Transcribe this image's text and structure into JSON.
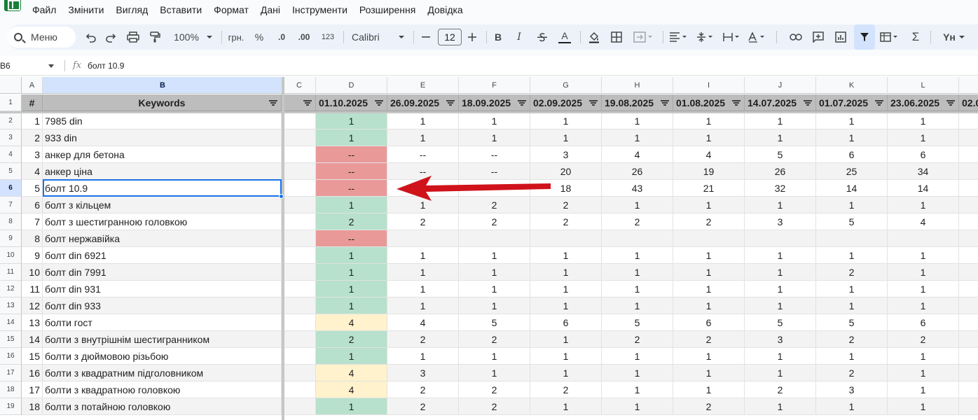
{
  "menu": [
    "Файл",
    "Змінити",
    "Вигляд",
    "Вставити",
    "Формат",
    "Дані",
    "Інструменти",
    "Розширення",
    "Довідка"
  ],
  "toolbar": {
    "menu_label": "Меню",
    "zoom": "100%",
    "currency": "грн.",
    "percent": "%",
    "dec_decrease": ".0",
    "dec_increase": ".00",
    "number_format": "123",
    "font": "Calibri",
    "font_size": "12",
    "bold": "B",
    "italic": "I",
    "text_color": "A",
    "sum": "Σ",
    "input_tools": "Yн"
  },
  "formula_bar": {
    "cell_ref": "B6",
    "fx": "fx",
    "value": "болт 10.9"
  },
  "columns": [
    "A",
    "B",
    "C",
    "D",
    "E",
    "F",
    "G",
    "H",
    "I",
    "J",
    "K",
    "L"
  ],
  "header_row": {
    "num": "#",
    "keyword": "Keywords",
    "dates": [
      "01.10.2025",
      "26.09.2025",
      "18.09.2025",
      "02.09.2025",
      "19.08.2025",
      "01.08.2025",
      "14.07.2025",
      "01.07.2025",
      "23.06.2025",
      "02.0"
    ]
  },
  "row_numbers": [
    "1",
    "2",
    "3",
    "4",
    "5",
    "6",
    "7",
    "8",
    "9",
    "10",
    "11",
    "12",
    "13",
    "14",
    "15",
    "16",
    "17",
    "18",
    "19"
  ],
  "rows": [
    {
      "n": "1",
      "kw": "7985 din",
      "v": [
        "1",
        "1",
        "1",
        "1",
        "1",
        "1",
        "1",
        "1",
        "1"
      ]
    },
    {
      "n": "2",
      "kw": "933 din",
      "v": [
        "1",
        "1",
        "1",
        "1",
        "1",
        "1",
        "1",
        "1",
        "1"
      ]
    },
    {
      "n": "3",
      "kw": "анкер для бетона",
      "v": [
        "--",
        "--",
        "--",
        "3",
        "4",
        "4",
        "5",
        "6",
        "6"
      ]
    },
    {
      "n": "4",
      "kw": "анкер ціна",
      "v": [
        "--",
        "--",
        "--",
        "20",
        "26",
        "19",
        "26",
        "25",
        "34"
      ]
    },
    {
      "n": "5",
      "kw": "болт 10.9",
      "v": [
        "--",
        "",
        "",
        "18",
        "43",
        "21",
        "32",
        "14",
        "14"
      ]
    },
    {
      "n": "6",
      "kw": "болт з кільцем",
      "v": [
        "1",
        "1",
        "2",
        "2",
        "1",
        "1",
        "1",
        "1",
        "1"
      ]
    },
    {
      "n": "7",
      "kw": "болт з шестигранною головкою",
      "v": [
        "2",
        "2",
        "2",
        "2",
        "2",
        "2",
        "3",
        "5",
        "4"
      ]
    },
    {
      "n": "8",
      "kw": "болт нержавійка",
      "v": [
        "--",
        "",
        "",
        "",
        "",
        "",
        "",
        "",
        ""
      ]
    },
    {
      "n": "9",
      "kw": "болт din 6921",
      "v": [
        "1",
        "1",
        "1",
        "1",
        "1",
        "1",
        "1",
        "1",
        "1"
      ]
    },
    {
      "n": "10",
      "kw": "болт din 7991",
      "v": [
        "1",
        "1",
        "1",
        "1",
        "1",
        "1",
        "1",
        "2",
        "1"
      ]
    },
    {
      "n": "11",
      "kw": "болт din 931",
      "v": [
        "1",
        "1",
        "1",
        "1",
        "1",
        "1",
        "1",
        "1",
        "1"
      ]
    },
    {
      "n": "12",
      "kw": "болт din 933",
      "v": [
        "1",
        "1",
        "1",
        "1",
        "1",
        "1",
        "1",
        "1",
        "1"
      ]
    },
    {
      "n": "13",
      "kw": "болти гост",
      "v": [
        "4",
        "4",
        "5",
        "6",
        "5",
        "6",
        "5",
        "5",
        "6"
      ]
    },
    {
      "n": "14",
      "kw": "болти з внутрішнім шестигранником",
      "v": [
        "2",
        "2",
        "2",
        "1",
        "2",
        "2",
        "3",
        "2",
        "2"
      ]
    },
    {
      "n": "15",
      "kw": "болти з дюймовою різьбою",
      "v": [
        "1",
        "1",
        "1",
        "1",
        "1",
        "1",
        "1",
        "1",
        "1"
      ]
    },
    {
      "n": "16",
      "kw": "болти з квадратним підголовником",
      "v": [
        "4",
        "3",
        "1",
        "1",
        "1",
        "1",
        "1",
        "2",
        "1"
      ]
    },
    {
      "n": "17",
      "kw": "болти з квадратною головкою",
      "v": [
        "4",
        "2",
        "2",
        "2",
        "1",
        "1",
        "2",
        "3",
        "1"
      ]
    },
    {
      "n": "18",
      "kw": "болти з потайною головкою",
      "v": [
        "1",
        "2",
        "2",
        "1",
        "1",
        "2",
        "1",
        "1",
        "1"
      ]
    }
  ],
  "colors": {
    "green": "#b7e1cd",
    "red": "#ea9999",
    "yellow": "#fff2cc",
    "stripe": "#f3f3f3",
    "arrow": "#d0121b",
    "header_gray": "#bdbdbd"
  }
}
